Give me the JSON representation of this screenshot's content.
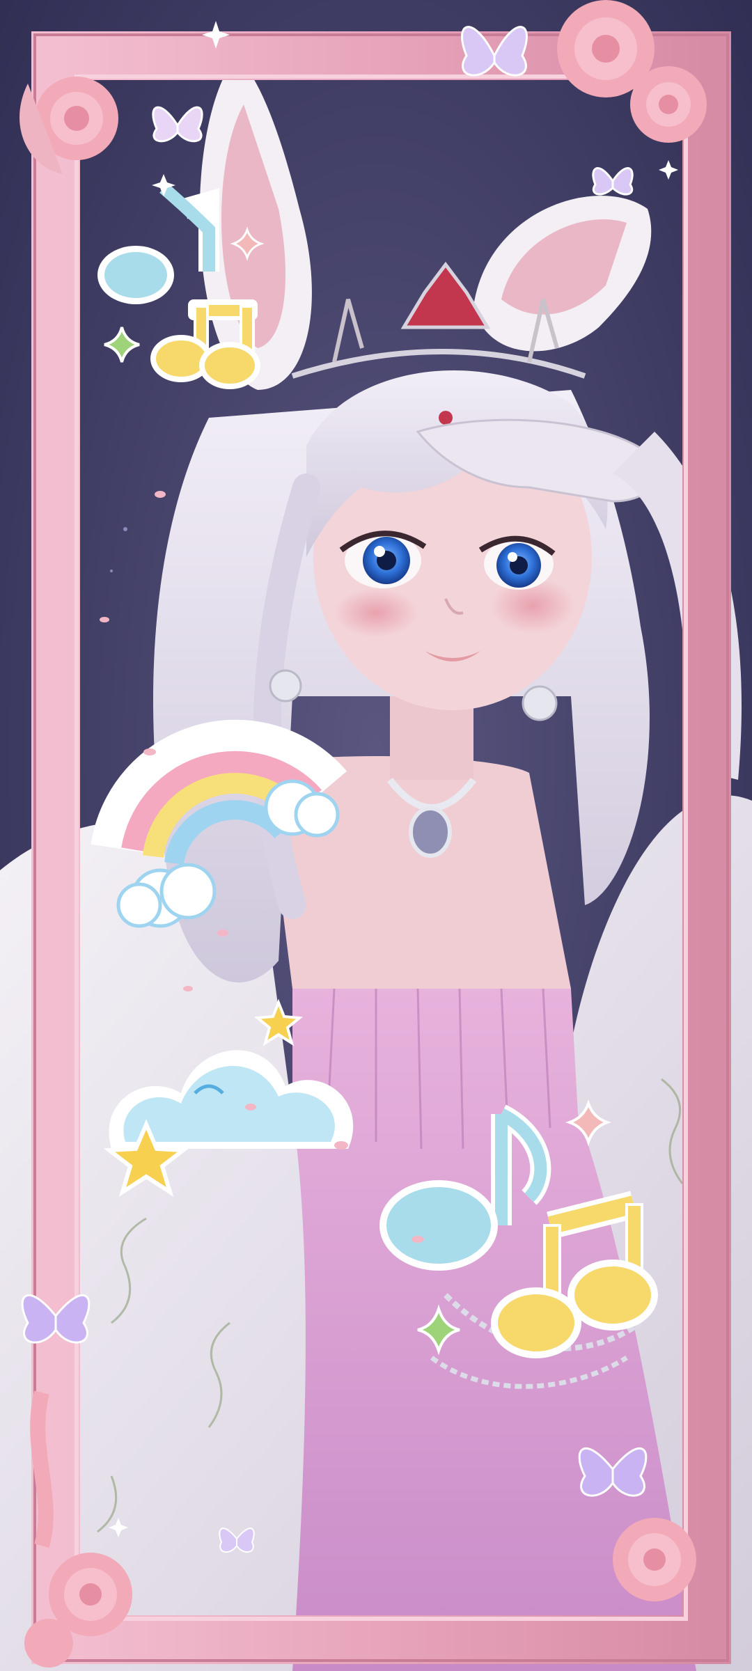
{
  "image": {
    "description_kind": "wallpaper",
    "colors": {
      "background": "#3d3b63",
      "frame_pink": "#e9a9bd",
      "hair": "#e8e2ef",
      "skin": "#f2d2d6",
      "dress_pink": "#d89fd3",
      "robe": "#ebe6ef",
      "note_blue": "#a9dcea",
      "note_yellow": "#f6d96a",
      "rainbow_pink": "#f4a9c0",
      "rainbow_yellow": "#f7e07a",
      "rainbow_blue": "#9fd4f0",
      "eye_blue": "#2d6fd6"
    },
    "stickers": [
      "music-note-icon",
      "rainbow-icon",
      "cloud-icon",
      "star-icon",
      "sparkle-icon",
      "butterfly-icon",
      "rose-icon"
    ]
  }
}
